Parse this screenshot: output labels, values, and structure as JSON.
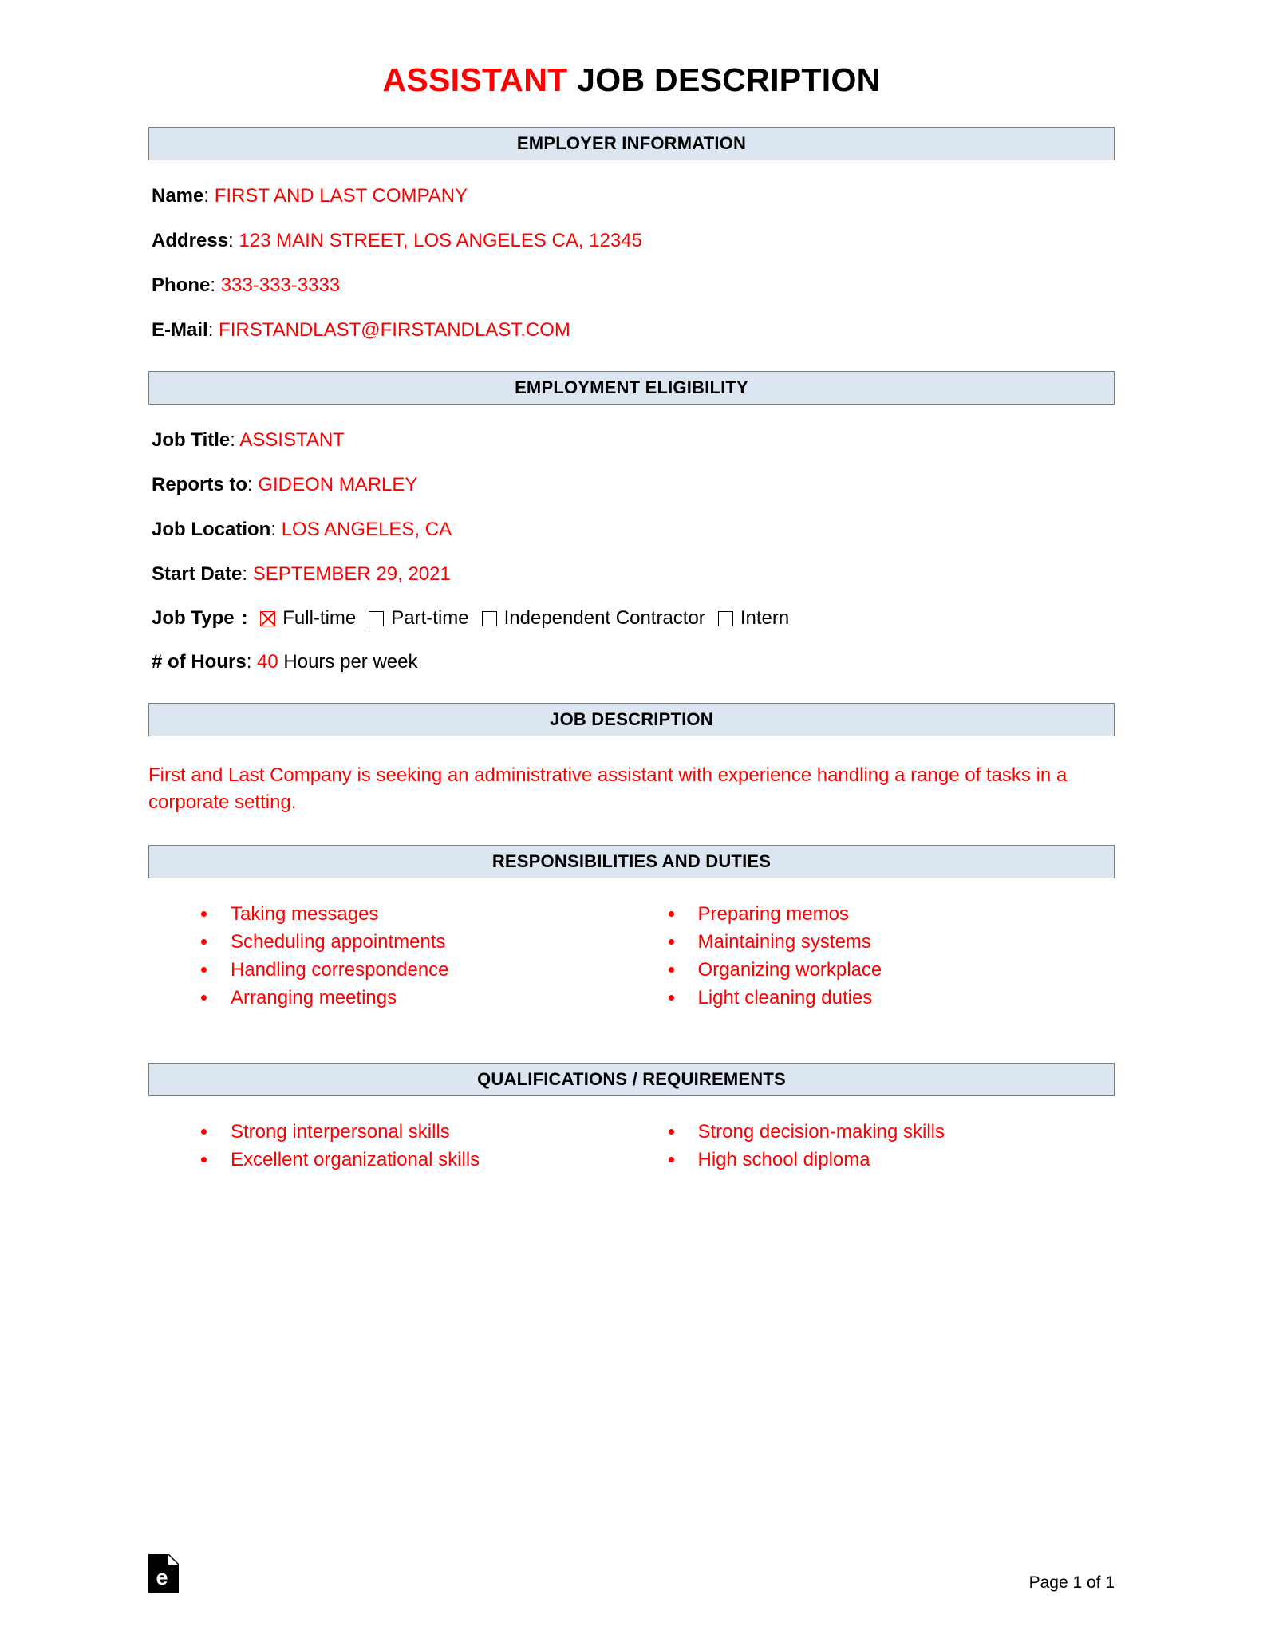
{
  "title": {
    "accent": "ASSISTANT",
    "rest": " JOB DESCRIPTION"
  },
  "sections": {
    "employer_information": "EMPLOYER INFORMATION",
    "employment_eligibility": "EMPLOYMENT ELIGIBILITY",
    "job_description": "JOB DESCRIPTION",
    "responsibilities": "RESPONSIBILITIES AND DUTIES",
    "qualifications": "QUALIFICATIONS / REQUIREMENTS"
  },
  "employer": {
    "name_label": "Name",
    "name_value": "FIRST AND LAST COMPANY",
    "address_label": "Address",
    "address_value": "123 MAIN STREET, LOS ANGELES CA, 12345",
    "phone_label": "Phone",
    "phone_value": "333-333-3333",
    "email_label": "E-Mail",
    "email_value": "FIRSTANDLAST@FIRSTANDLAST.COM"
  },
  "eligibility": {
    "job_title_label": "Job Title",
    "job_title_value": "ASSISTANT",
    "reports_to_label": "Reports to",
    "reports_to_value": "GIDEON MARLEY",
    "job_location_label": "Job Location",
    "job_location_value": "LOS ANGELES, CA",
    "start_date_label": "Start Date",
    "start_date_value": "SEPTEMBER 29, 2021",
    "job_type_label": "Job Type",
    "job_type_options": [
      {
        "label": "Full-time",
        "checked": true
      },
      {
        "label": "Part-time",
        "checked": false
      },
      {
        "label": "Independent Contractor",
        "checked": false
      },
      {
        "label": "Intern",
        "checked": false
      }
    ],
    "hours_label": "# of Hours",
    "hours_value": "40",
    "hours_suffix": "Hours per week"
  },
  "job_description_text": "First and Last Company is seeking an administrative assistant with experience handling a range of tasks in a corporate setting.",
  "responsibilities": {
    "left": [
      "Taking messages",
      "Scheduling appointments",
      "Handling correspondence",
      "Arranging meetings"
    ],
    "right": [
      "Preparing memos",
      "Maintaining systems",
      "Organizing workplace",
      "Light cleaning duties"
    ]
  },
  "qualifications": {
    "left": [
      "Strong interpersonal skills",
      "Excellent organizational skills"
    ],
    "right": [
      "Strong decision-making skills",
      "High school diploma"
    ]
  },
  "footer": {
    "logo_letter": "e",
    "page_number": "Page 1 of 1"
  },
  "colors": {
    "accent_red": "#fe0000",
    "section_bar_bg": "#dce6f1",
    "section_bar_border": "#7e7e7e"
  },
  "separators": {
    "colon": ": ",
    "space": " "
  }
}
